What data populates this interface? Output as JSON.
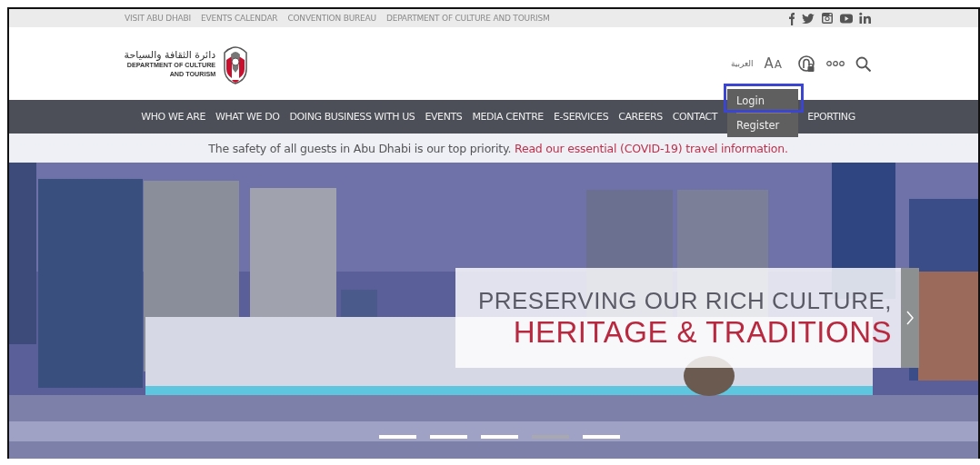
{
  "top_links": [
    "VISIT ABU DHABI",
    "EVENTS CALENDAR",
    "CONVENTION BUREAU",
    "DEPARTMENT OF CULTURE AND TOURISM"
  ],
  "social": [
    {
      "kind": "facebook"
    },
    {
      "kind": "twitter"
    },
    {
      "kind": "instagram"
    },
    {
      "kind": "youtube"
    },
    {
      "kind": "linkedin"
    }
  ],
  "logo": {
    "arabic": "دائرة الثقافة والسياحة",
    "line_1": "DEPARTMENT OF CULTURE",
    "line_2": "AND TOURISM"
  },
  "tools": {
    "language": "العربية",
    "text_size": [
      "A",
      "A"
    ]
  },
  "nav": [
    "WHO WE ARE",
    "WHAT WE DO",
    "DOING BUSINESS WITH US",
    "EVENTS",
    "MEDIA CENTRE",
    "E-SERVICES",
    "CAREERS",
    "CONTACT",
    "EPORTING"
  ],
  "account_menu": {
    "items": [
      "Login",
      "Register"
    ],
    "highlighted": true
  },
  "notice": {
    "text": "The safety of all guests in Abu Dhabi is our top priority.",
    "link": "Read our essential (COVID-19) travel information."
  },
  "hero": {
    "kind": "picture",
    "line_1": "PRESERVING OUR RICH CULTURE,",
    "line_2": "HERITAGE & TRADITIONS"
  },
  "slides": [
    {
      "selected": false
    },
    {
      "selected": false
    },
    {
      "selected": false
    },
    {
      "selected": true
    },
    {
      "selected": false
    }
  ]
}
